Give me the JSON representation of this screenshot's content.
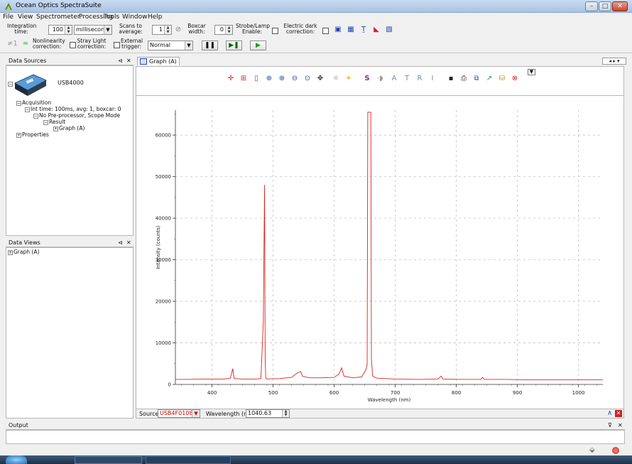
{
  "window": {
    "title": "Ocean Optics SpectraSuite"
  },
  "menu": [
    "File",
    "View",
    "Spectrometer",
    "Processing",
    "Tools",
    "Window",
    "Help"
  ],
  "toolbar": {
    "integration_label": "Integration time:",
    "integration_value": "100",
    "integration_unit": "milliseconds",
    "scans_label": "Scans to average:",
    "scans_value": "1",
    "boxcar_label": "Boxcar width:",
    "boxcar_value": "0",
    "strobe_label": "Strobe/Lamp Enable:",
    "dark_label": "Electric dark correction:",
    "nonlinearity_label": "Nonlinearity correction:",
    "straylight_label": "Stray Light correction:",
    "trigger_label": "External trigger:",
    "trigger_value": "Normal",
    "pause_glyph": "❚❚",
    "step_glyph": "▶❚",
    "play_glyph": "▶"
  },
  "data_sources": {
    "title": "Data Sources",
    "device": "USB4000",
    "tree": [
      "Acquisition",
      "Int time: 100ms, avg: 1, boxcar: 0",
      "No Pre-processor, Scope Mode",
      "Result",
      "Graph (A)",
      "Properties"
    ]
  },
  "data_views": {
    "title": "Data Views",
    "tree": [
      "Graph (A)"
    ]
  },
  "graph": {
    "tab_label": "Graph (A)",
    "source_label": "Source:",
    "source_value": "USB4F01085",
    "wavelength_label": "Wavelength (nm):",
    "wavelength_value": "1040.63"
  },
  "output": {
    "title": "Output"
  },
  "colors": {
    "trace": "#e02020",
    "source": "#cc0000"
  },
  "chart_data": {
    "type": "line",
    "xlabel": "Wavelength (nm)",
    "ylabel": "Intensity (counts)",
    "xlim": [
      340,
      1040
    ],
    "ylim": [
      0,
      66000
    ],
    "x_ticks": [
      400,
      500,
      600,
      700,
      800,
      900,
      1000
    ],
    "y_ticks": [
      0,
      10000,
      20000,
      30000,
      40000,
      50000,
      60000
    ],
    "grid": true,
    "series": [
      {
        "values_x": [
          340,
          360,
          380,
          400,
          420,
          430,
          434,
          436,
          438,
          450,
          470,
          480,
          484,
          486,
          487,
          488,
          490,
          510,
          530,
          540,
          545,
          548,
          552,
          560,
          580,
          600,
          608,
          612,
          616,
          630,
          645,
          652,
          654,
          655,
          656,
          657,
          658,
          660,
          661,
          663,
          670,
          700,
          740,
          770,
          775,
          778,
          800,
          840,
          843,
          846,
          880,
          920,
          960,
          1000,
          1040
        ],
        "values_y": [
          1200,
          1200,
          1300,
          1300,
          1300,
          1500,
          3800,
          1500,
          1400,
          1300,
          1300,
          1400,
          15000,
          48000,
          6000,
          1500,
          1300,
          1400,
          1700,
          2800,
          3100,
          2000,
          1800,
          1600,
          1600,
          1700,
          2500,
          4000,
          2000,
          1600,
          1800,
          3500,
          4800,
          65500,
          65500,
          65500,
          65500,
          65500,
          6000,
          2000,
          1500,
          1300,
          1200,
          1300,
          2000,
          1300,
          1200,
          1200,
          1700,
          1200,
          1200,
          1100,
          1100,
          1100,
          1100
        ]
      }
    ]
  }
}
